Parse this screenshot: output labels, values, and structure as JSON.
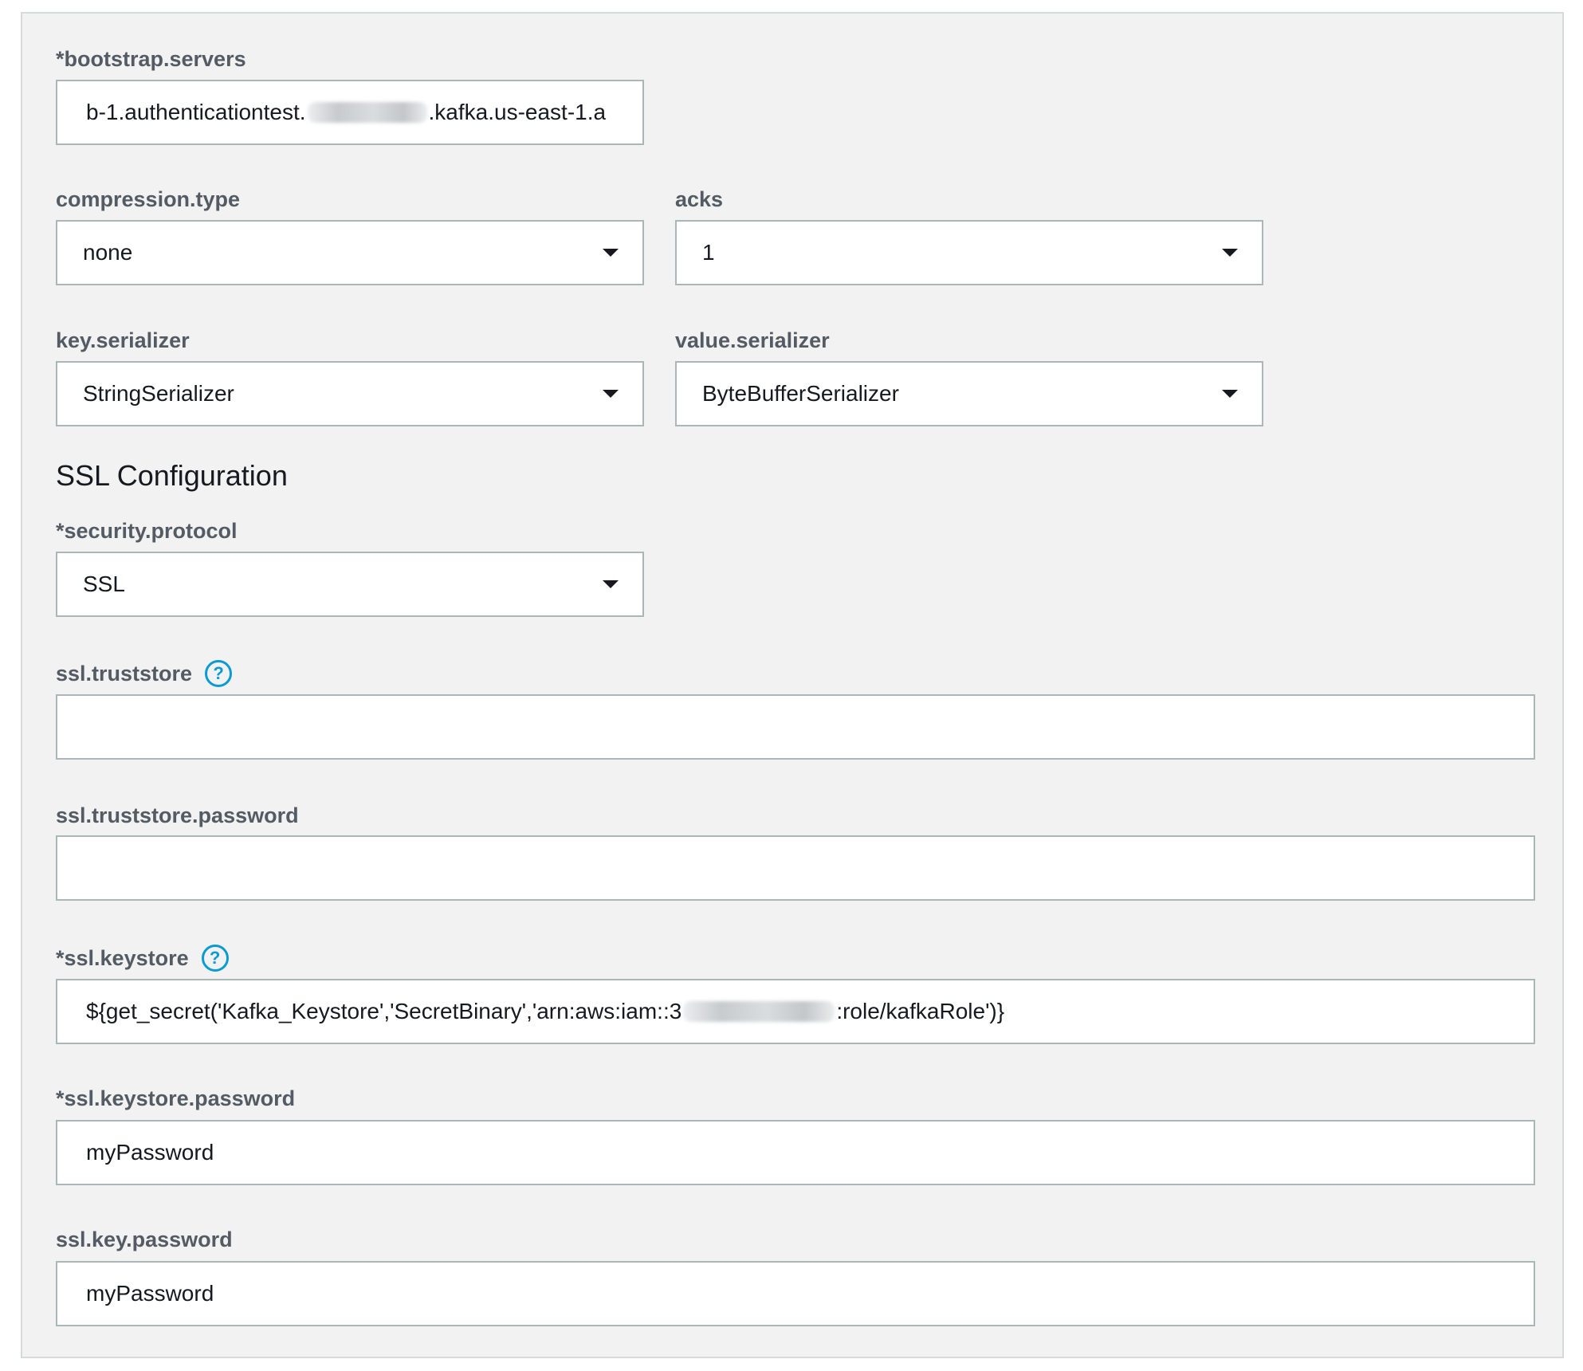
{
  "form": {
    "bootstrap_servers": {
      "label": "*bootstrap.servers",
      "value_prefix": "b-1.authenticationtest.",
      "value_suffix": ".kafka.us-east-1.a"
    },
    "compression_type": {
      "label": "compression.type",
      "value": "none"
    },
    "acks": {
      "label": "acks",
      "value": "1"
    },
    "key_serializer": {
      "label": "key.serializer",
      "value": "StringSerializer"
    },
    "value_serializer": {
      "label": "value.serializer",
      "value": "ByteBufferSerializer"
    },
    "ssl_section": {
      "title": "SSL Configuration"
    },
    "security_protocol": {
      "label": "*security.protocol",
      "value": "SSL"
    },
    "ssl_truststore": {
      "label": "ssl.truststore",
      "value": ""
    },
    "ssl_truststore_password": {
      "label": "ssl.truststore.password",
      "value": ""
    },
    "ssl_keystore": {
      "label": "*ssl.keystore",
      "value_prefix": "${get_secret('Kafka_Keystore','SecretBinary','arn:aws:iam::3",
      "value_suffix": ":role/kafkaRole')}"
    },
    "ssl_keystore_password": {
      "label": "*ssl.keystore.password",
      "value": "myPassword"
    },
    "ssl_key_password": {
      "label": "ssl.key.password",
      "value": "myPassword"
    }
  },
  "icons": {
    "help": "question-circle-icon",
    "dropdown": "caret-down-icon",
    "help_glyph": "?"
  },
  "colors": {
    "panel_background": "#f2f2f2",
    "label": "#545b64",
    "help_icon": "#0a9bd4",
    "input_border": "#aab7b8"
  }
}
